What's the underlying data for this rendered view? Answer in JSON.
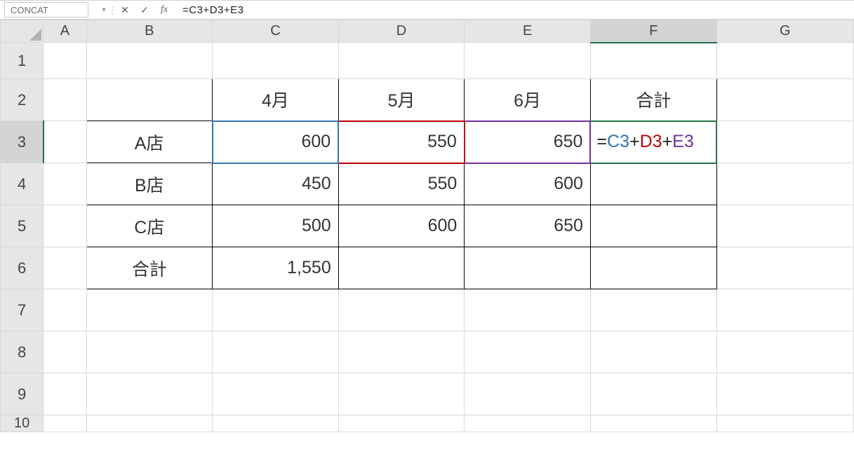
{
  "namebox": "CONCAT",
  "formula_bar": "=C3+D3+E3",
  "columns": [
    "A",
    "B",
    "C",
    "D",
    "E",
    "F",
    "G"
  ],
  "rows": [
    "1",
    "2",
    "3",
    "4",
    "5",
    "6",
    "7",
    "8",
    "9",
    "10"
  ],
  "active_col": "F",
  "active_row": "3",
  "hdr": {
    "col_c": "4月",
    "col_d": "5月",
    "col_e": "6月",
    "col_f": "合計"
  },
  "stores": {
    "a": "A店",
    "b": "B店",
    "c": "C店",
    "sum": "合計"
  },
  "vals": {
    "a_apr": "600",
    "a_may": "550",
    "a_jun": "650",
    "b_apr": "450",
    "b_may": "550",
    "b_jun": "600",
    "c_apr": "500",
    "c_may": "600",
    "c_jun": "650",
    "sum_apr": "1,550"
  },
  "formula_tokens": {
    "eq": "=",
    "c3": "C3",
    "p1": "+",
    "d3": "D3",
    "p2": "+",
    "e3": "E3"
  },
  "icons": {
    "cancel": "✕",
    "accept": "✓",
    "fx": "fx",
    "dropdown": "▾",
    "divider": "⋮"
  }
}
